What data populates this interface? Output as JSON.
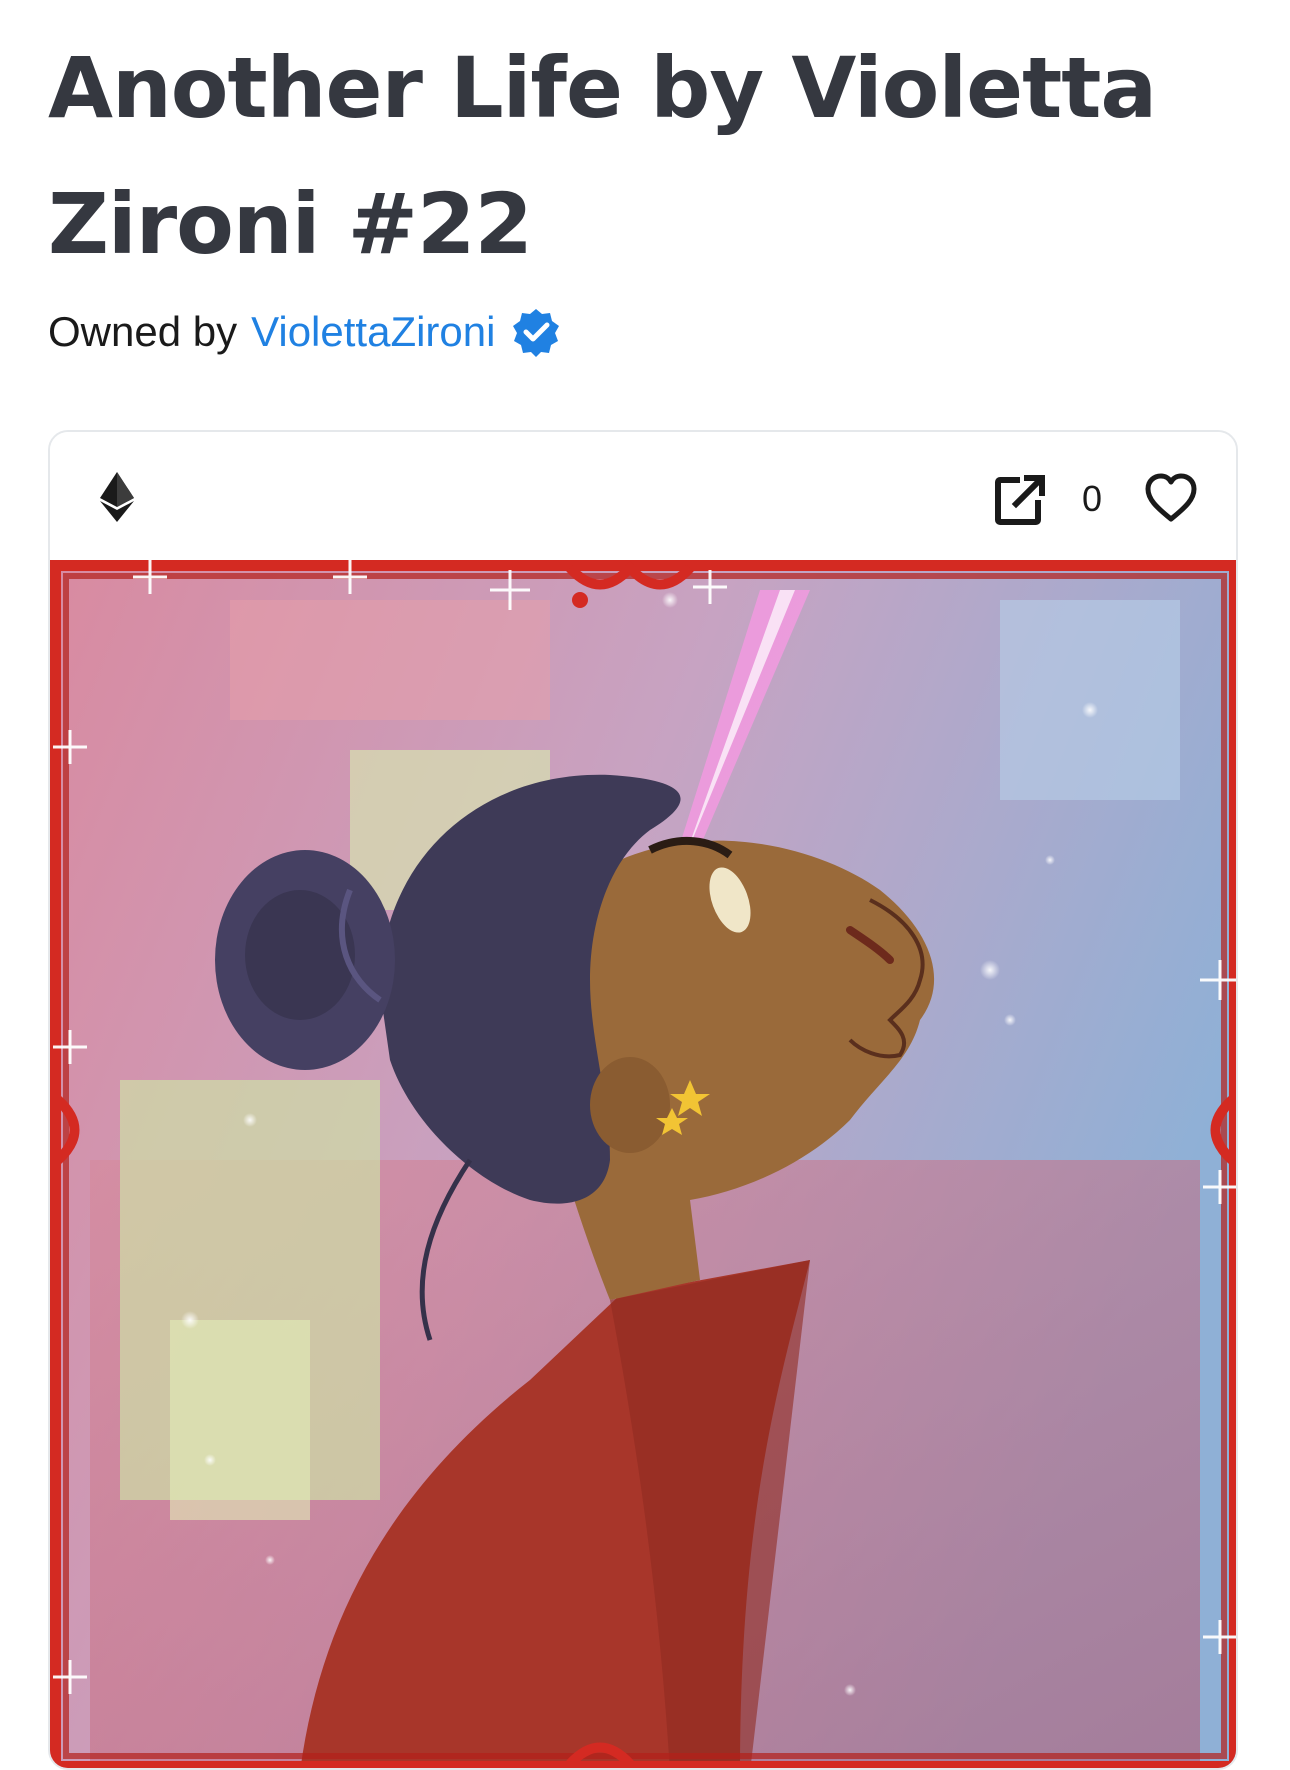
{
  "asset": {
    "title": "Another Life by Violetta Zironi #22"
  },
  "owner": {
    "prefix": "Owned by",
    "name": "ViolettaZironi",
    "verified": true,
    "link_color": "#2081e2"
  },
  "card": {
    "chain_icon": "ethereum-icon",
    "external_link_icon": "external-link-icon",
    "favorite_count": "0",
    "favorite_icon": "heart-outline-icon"
  },
  "artwork": {
    "subject": "illustrated portrait",
    "frame_color": "#d42a22"
  }
}
